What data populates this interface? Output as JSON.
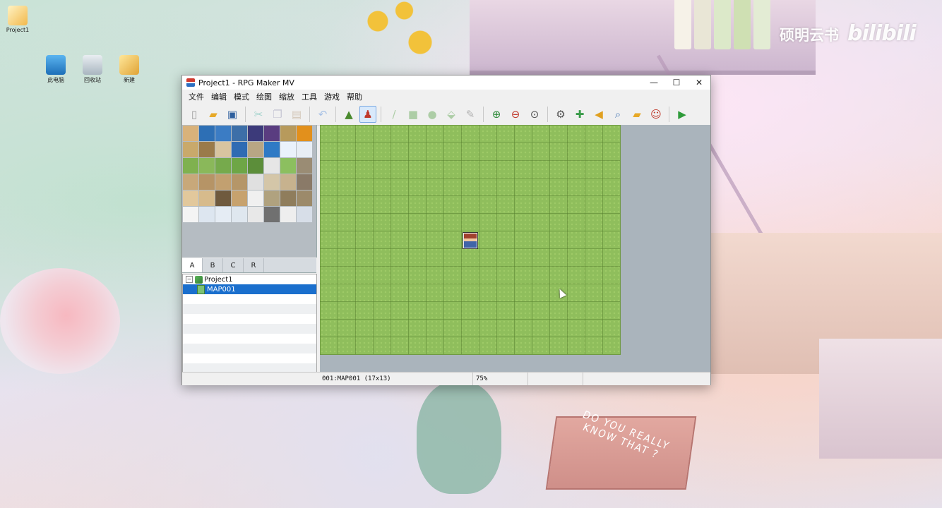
{
  "desktop": {
    "icons": [
      {
        "label": "Project1"
      },
      {
        "label": "此电脑"
      },
      {
        "label": "回收站"
      },
      {
        "label": "新建"
      }
    ],
    "watermark": {
      "channel": "硕明云书",
      "logo": "bilibili"
    },
    "wallpaper_book": "DO YOU REALLY KNOW THAT ?"
  },
  "window": {
    "title": "Project1 - RPG Maker MV",
    "controls": {
      "minimize": "—",
      "maximize": "☐",
      "close": "✕"
    }
  },
  "menu": [
    "文件",
    "编辑",
    "模式",
    "绘图",
    "缩放",
    "工具",
    "游戏",
    "帮助"
  ],
  "toolbar": {
    "icons": [
      "new-project-icon",
      "open-project-icon",
      "save-project-icon",
      "cut-icon",
      "copy-icon",
      "paste-icon",
      "undo-icon",
      "map-mode-icon",
      "event-mode-icon",
      "pencil-icon",
      "rectangle-icon",
      "ellipse-icon",
      "fill-icon",
      "shadow-pen-icon",
      "zoom-in-icon",
      "zoom-out-icon",
      "actual-size-icon",
      "database-icon",
      "plugin-manager-icon",
      "sound-test-icon",
      "event-searcher-icon",
      "resource-manager-icon",
      "character-generator-icon",
      "playtest-icon"
    ]
  },
  "tileset_tabs": [
    "A",
    "B",
    "C",
    "R"
  ],
  "tree": {
    "project": "Project1",
    "maps": [
      "MAP001"
    ]
  },
  "status": {
    "map": "001:MAP001 (17x13)",
    "zoom": "75%"
  },
  "colors": {
    "accent": "#1a6fcd",
    "grass": "#8fbe5c",
    "map_bg": "#aab4bc"
  }
}
